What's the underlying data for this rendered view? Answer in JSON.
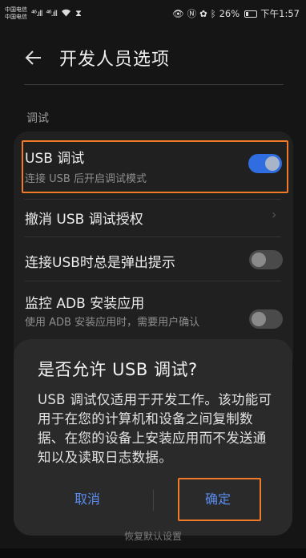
{
  "status_bar": {
    "carrier_1": "中国电信",
    "carrier_2": "中国电信",
    "network_1": "⁴⁶.ıll",
    "network_2": "⁴⁶.ıll",
    "wifi_icon": "wifi-icon",
    "battery_pct": "26%",
    "time": "下午1:57"
  },
  "header": {
    "title": "开发人员选项"
  },
  "section": {
    "label": "调试"
  },
  "rows": {
    "usb_debug": {
      "title": "USB 调试",
      "subtitle": "连接 USB 后开启调试模式",
      "toggle_on": true
    },
    "revoke": {
      "title": "撤消 USB 调试授权"
    },
    "prompt_on_usb": {
      "title": "连接USB时总是弹出提示",
      "toggle_on": false
    },
    "monitor_adb": {
      "title": "监控 ADB 安装应用",
      "subtitle": "使用 ADB 安装应用时，需要用户确认",
      "toggle_on": false
    }
  },
  "dialog": {
    "title": "是否允许 USB 调试?",
    "body": "USB 调试仅适用于开发工作。该功能可用于在您的计算机和设备之间复制数据、在您的设备上安装应用而不发送通知以及读取日志数据。",
    "cancel_label": "取消",
    "ok_label": "确定"
  },
  "footer": {
    "text": "恢复默认设置"
  },
  "colors": {
    "accent": "#2f6de0",
    "highlight": "#f07a28",
    "button_text": "#5a8cf0"
  }
}
